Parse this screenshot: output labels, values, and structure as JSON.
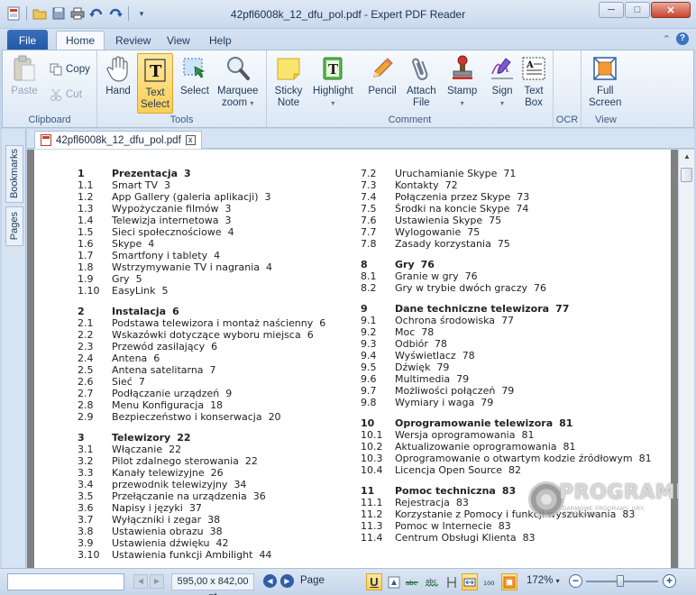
{
  "window": {
    "title": "42pfl6008k_12_dfu_pol.pdf - Expert PDF Reader",
    "controls": {
      "minimize": "─",
      "maximize": "□",
      "close": "✕"
    }
  },
  "quick_access": [
    "app-menu-icon",
    "open-icon",
    "save-icon",
    "print-icon",
    "undo-icon",
    "redo-icon",
    "customize-icon"
  ],
  "tabs": {
    "file": "File",
    "items": [
      {
        "label": "Home",
        "active": true
      },
      {
        "label": "Review",
        "active": false
      },
      {
        "label": "View",
        "active": false
      },
      {
        "label": "Help",
        "active": false
      }
    ]
  },
  "ribbon": {
    "clipboard": {
      "label": "Clipboard",
      "paste": "Paste",
      "copy": "Copy",
      "cut": "Cut"
    },
    "tools": {
      "label": "Tools",
      "hand": "Hand",
      "text_select_1": "Text",
      "text_select_2": "Select",
      "select": "Select",
      "marquee_1": "Marquee",
      "marquee_2": "zoom"
    },
    "comment": {
      "label": "Comment",
      "sticky_1": "Sticky",
      "sticky_2": "Note",
      "highlight": "Highlight",
      "pencil": "Pencil",
      "attach_1": "Attach",
      "attach_2": "File",
      "stamp": "Stamp",
      "sign": "Sign",
      "textbox_1": "Text",
      "textbox_2": "Box"
    },
    "ocr": {
      "label": "OCR"
    },
    "view": {
      "label": "View",
      "fullscreen_1": "Full",
      "fullscreen_2": "Screen"
    }
  },
  "side_tabs": {
    "bookmarks": "Bookmarks",
    "pages": "Pages"
  },
  "document_tab": {
    "name": "42pfl6008k_12_dfu_pol.pdf",
    "close": "x"
  },
  "toc": {
    "left": [
      {
        "head": {
          "num": "1",
          "title": "Prezentacja",
          "page": "3"
        },
        "items": [
          {
            "num": "1.1",
            "title": "Smart TV",
            "page": "3"
          },
          {
            "num": "1.2",
            "title": "App Gallery (galeria aplikacji)",
            "page": "3"
          },
          {
            "num": "1.3",
            "title": "Wypożyczanie filmów",
            "page": "3"
          },
          {
            "num": "1.4",
            "title": "Telewizja internetowa",
            "page": "3"
          },
          {
            "num": "1.5",
            "title": "Sieci społecznościowe",
            "page": "4"
          },
          {
            "num": "1.6",
            "title": "Skype",
            "page": "4"
          },
          {
            "num": "1.7",
            "title": "Smartfony i tablety",
            "page": "4"
          },
          {
            "num": "1.8",
            "title": "Wstrzymywanie TV i nagrania",
            "page": "4"
          },
          {
            "num": "1.9",
            "title": "Gry",
            "page": "5"
          },
          {
            "num": "1.10",
            "title": "EasyLink",
            "page": "5"
          }
        ]
      },
      {
        "head": {
          "num": "2",
          "title": "Instalacja",
          "page": "6"
        },
        "items": [
          {
            "num": "2.1",
            "title": "Podstawa telewizora i montaż naścienny",
            "page": "6"
          },
          {
            "num": "2.2",
            "title": "Wskazówki dotyczące wyboru miejsca",
            "page": "6"
          },
          {
            "num": "2.3",
            "title": "Przewód zasilający",
            "page": "6"
          },
          {
            "num": "2.4",
            "title": "Antena",
            "page": "6"
          },
          {
            "num": "2.5",
            "title": "Antena satelitarna",
            "page": "7"
          },
          {
            "num": "2.6",
            "title": "Sieć",
            "page": "7"
          },
          {
            "num": "2.7",
            "title": "Podłączanie urządzeń",
            "page": "9"
          },
          {
            "num": "2.8",
            "title": "Menu Konfiguracja",
            "page": "18"
          },
          {
            "num": "2.9",
            "title": "Bezpieczeństwo i konserwacja",
            "page": "20"
          }
        ]
      },
      {
        "head": {
          "num": "3",
          "title": "Telewizory",
          "page": "22"
        },
        "items": [
          {
            "num": "3.1",
            "title": "Włączanie",
            "page": "22"
          },
          {
            "num": "3.2",
            "title": "Pilot zdalnego sterowania",
            "page": "22"
          },
          {
            "num": "3.3",
            "title": "Kanały telewizyjne",
            "page": "26"
          },
          {
            "num": "3.4",
            "title": "przewodnik telewizyjny",
            "page": "34"
          },
          {
            "num": "3.5",
            "title": "Przełączanie na urządzenia",
            "page": "36"
          },
          {
            "num": "3.6",
            "title": "Napisy i języki",
            "page": "37"
          },
          {
            "num": "3.7",
            "title": "Wyłączniki i zegar",
            "page": "38"
          },
          {
            "num": "3.8",
            "title": "Ustawienia obrazu",
            "page": "38"
          },
          {
            "num": "3.9",
            "title": "Ustawienia dźwięku",
            "page": "42"
          },
          {
            "num": "3.10",
            "title": "Ustawienia funkcji Ambilight",
            "page": "44"
          }
        ]
      }
    ],
    "right": [
      {
        "head": null,
        "items": [
          {
            "num": "7.2",
            "title": "Uruchamianie Skype",
            "page": "71"
          },
          {
            "num": "7.3",
            "title": "Kontakty",
            "page": "72"
          },
          {
            "num": "7.4",
            "title": "Połączenia przez Skype",
            "page": "73"
          },
          {
            "num": "7.5",
            "title": "Środki na koncie Skype",
            "page": "74"
          },
          {
            "num": "7.6",
            "title": "Ustawienia Skype",
            "page": "75"
          },
          {
            "num": "7.7",
            "title": "Wylogowanie",
            "page": "75"
          },
          {
            "num": "7.8",
            "title": "Zasady korzystania",
            "page": "75"
          }
        ]
      },
      {
        "head": {
          "num": "8",
          "title": "Gry",
          "page": "76"
        },
        "items": [
          {
            "num": "8.1",
            "title": "Granie w gry",
            "page": "76"
          },
          {
            "num": "8.2",
            "title": "Gry w trybie dwóch graczy",
            "page": "76"
          }
        ]
      },
      {
        "head": {
          "num": "9",
          "title": "Dane techniczne telewizora",
          "page": "77"
        },
        "items": [
          {
            "num": "9.1",
            "title": "Ochrona środowiska",
            "page": "77"
          },
          {
            "num": "9.2",
            "title": "Moc",
            "page": "78"
          },
          {
            "num": "9.3",
            "title": "Odbiór",
            "page": "78"
          },
          {
            "num": "9.4",
            "title": "Wyświetlacz",
            "page": "78"
          },
          {
            "num": "9.5",
            "title": "Dźwięk",
            "page": "79"
          },
          {
            "num": "9.6",
            "title": "Multimedia",
            "page": "79"
          },
          {
            "num": "9.7",
            "title": "Możliwości połączeń",
            "page": "79"
          },
          {
            "num": "9.8",
            "title": "Wymiary i waga",
            "page": "79"
          }
        ]
      },
      {
        "head": {
          "num": "10",
          "title": "Oprogramowanie telewizora",
          "page": "81"
        },
        "items": [
          {
            "num": "10.1",
            "title": "Wersja oprogramowania",
            "page": "81"
          },
          {
            "num": "10.2",
            "title": "Aktualizowanie oprogramowania",
            "page": "81"
          },
          {
            "num": "10.3",
            "title": "Oprogramowanie o otwartym kodzie źródłowym",
            "page": "81"
          },
          {
            "num": "10.4",
            "title": "Licencja Open Source",
            "page": "82"
          }
        ]
      },
      {
        "head": {
          "num": "11",
          "title": "Pomoc techniczna",
          "page": "83"
        },
        "items": [
          {
            "num": "11.1",
            "title": "Rejestracja",
            "page": "83"
          },
          {
            "num": "11.2",
            "title": "Korzystanie z Pomocy i funkcji wyszukiwania",
            "page": "83"
          },
          {
            "num": "11.3",
            "title": "Pomoc w Internecie",
            "page": "83"
          },
          {
            "num": "11.4",
            "title": "Centrum Obsługi Klienta",
            "page": "83"
          }
        ]
      }
    ]
  },
  "watermark": {
    "brand": "PROGRAMKI.PL",
    "tagline": "DARMOWE PROGRAMY, GRY, STEROWNIKI"
  },
  "status": {
    "page_size": "595,00 x 842,00 pt",
    "page_label": "Page",
    "zoom": "172%",
    "zoom_minus": "−",
    "zoom_plus": "+"
  }
}
